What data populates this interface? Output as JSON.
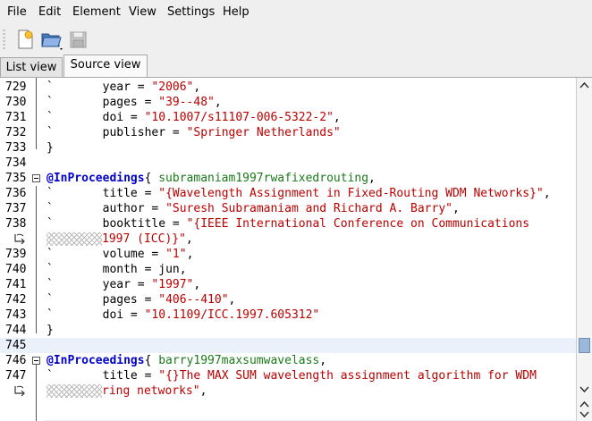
{
  "menu": [
    "File",
    "Edit",
    "Element",
    "View",
    "Settings",
    "Help"
  ],
  "toolbar": {
    "icons": [
      "new-document-icon",
      "open-folder-icon",
      "save-disk-icon"
    ]
  },
  "tabs": [
    {
      "label": "List view",
      "active": false
    },
    {
      "label": "Source view",
      "active": true
    }
  ],
  "lines": [
    {
      "num": "729",
      "dot": "`",
      "indent": "       ",
      "field": "year",
      "value": "\"2006\"",
      "tail": ","
    },
    {
      "num": "730",
      "dot": "`",
      "indent": "       ",
      "field": "pages",
      "value": "\"39--48\"",
      "tail": ","
    },
    {
      "num": "731",
      "dot": "`",
      "indent": "       ",
      "field": "doi",
      "value": "\"10.1007/s11107-006-5322-2\"",
      "tail": ","
    },
    {
      "num": "732",
      "dot": "`",
      "indent": "       ",
      "field": "publisher",
      "value": "\"Springer Netherlands\"",
      "tail": ""
    },
    {
      "num": "733",
      "text": "}"
    },
    {
      "num": "734",
      "text": ""
    },
    {
      "num": "735",
      "entry": "@InProceedings",
      "brace": "{ ",
      "citekey": "subramaniam1997rwafixedrouting",
      "tail": ","
    },
    {
      "num": "736",
      "dot": "`",
      "indent": "       ",
      "field": "title",
      "value": "\"{Wavelength Assignment in Fixed-Routing WDM Networks}\"",
      "tail": ","
    },
    {
      "num": "737",
      "dot": "`",
      "indent": "       ",
      "field": "author",
      "value": "\"Suresh Subramaniam and Richard A. Barry\"",
      "tail": ","
    },
    {
      "num": "738",
      "dot": "`",
      "indent": "       ",
      "field": "booktitle",
      "value": "\"{IEEE International Conference on Communications",
      "tail": ""
    },
    {
      "num": "",
      "wrapcont": "1997 (ICC)}\"",
      "tail": ","
    },
    {
      "num": "739",
      "dot": "`",
      "indent": "       ",
      "field": "volume",
      "value": "\"1\"",
      "tail": ","
    },
    {
      "num": "740",
      "dot": "`",
      "indent": "       ",
      "field": "month",
      "plain": "jun",
      "tail": ","
    },
    {
      "num": "741",
      "dot": "`",
      "indent": "       ",
      "field": "year",
      "value": "\"1997\"",
      "tail": ","
    },
    {
      "num": "742",
      "dot": "`",
      "indent": "       ",
      "field": "pages",
      "value": "\"406--410\"",
      "tail": ","
    },
    {
      "num": "743",
      "dot": "`",
      "indent": "       ",
      "field": "doi",
      "value": "\"10.1109/ICC.1997.605312\"",
      "tail": ""
    },
    {
      "num": "744",
      "text": "}"
    },
    {
      "num": "745",
      "text": "",
      "current": true
    },
    {
      "num": "746",
      "entry": "@InProceedings",
      "brace": "{ ",
      "citekey": "barry1997maxsumwavelass",
      "tail": ","
    },
    {
      "num": "747",
      "dot": "`",
      "indent": "       ",
      "field": "title",
      "value": "\"{}The MAX SUM wavelength assignment algorithm for WDM",
      "tail": ""
    },
    {
      "num": "",
      "wrapcont": "ring networks\"",
      "tail": ","
    }
  ]
}
